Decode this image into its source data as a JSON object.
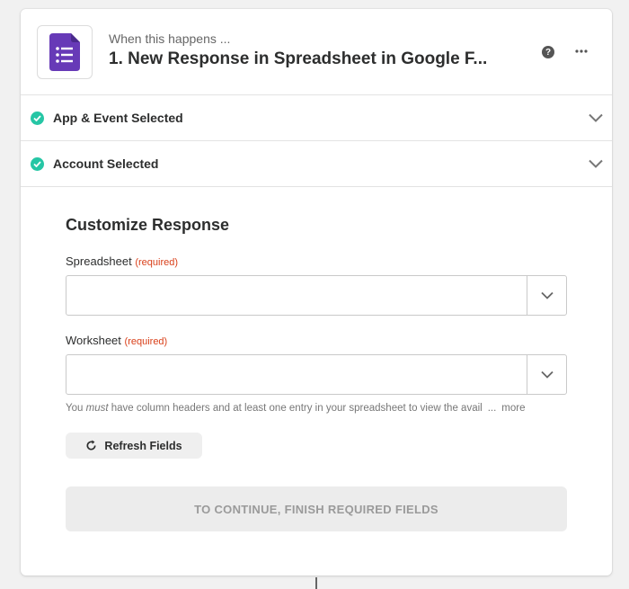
{
  "header": {
    "pre_title": "When this happens ...",
    "title": "1. New Response in Spreadsheet in Google F...",
    "help_glyph": "?",
    "app_icon": "google-forms-icon",
    "brand_color": "#673ab7"
  },
  "sections": [
    {
      "label": "App & Event Selected",
      "status": "complete"
    },
    {
      "label": "Account Selected",
      "status": "complete"
    }
  ],
  "customize": {
    "heading": "Customize Response",
    "spreadsheet": {
      "label": "Spreadsheet",
      "required": "(required)",
      "value": ""
    },
    "worksheet": {
      "label": "Worksheet",
      "required": "(required)",
      "value": ""
    },
    "helper": {
      "pre": "You ",
      "em": "must",
      "post": " have column headers and at least one entry in your spreadsheet to view the avail",
      "ellipsis": "...",
      "more": "more"
    },
    "refresh_label": "Refresh Fields",
    "continue_label": "TO CONTINUE, FINISH REQUIRED FIELDS"
  },
  "colors": {
    "check": "#26c6a5",
    "required": "#d9401a"
  }
}
